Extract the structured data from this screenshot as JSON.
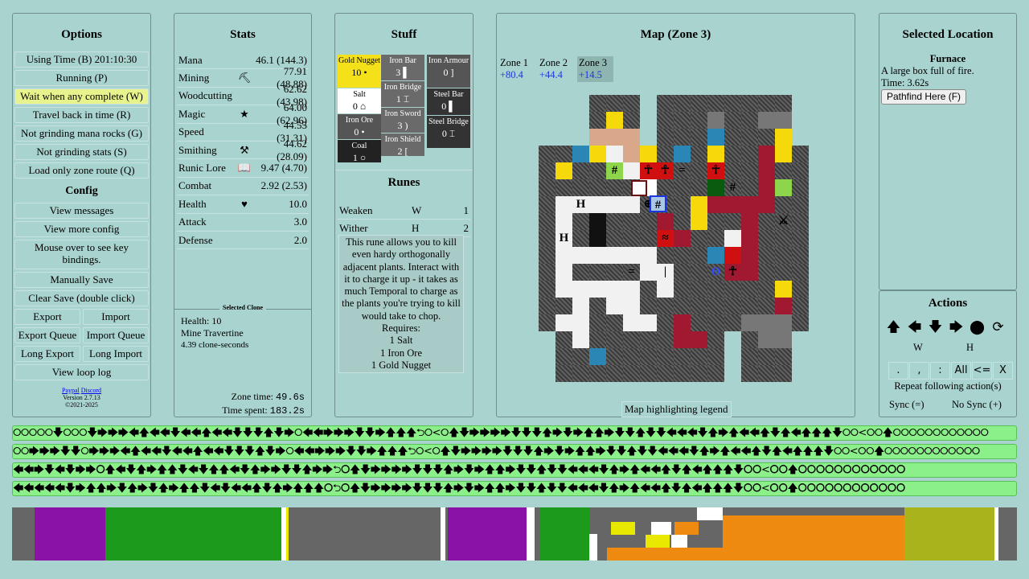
{
  "options": {
    "title": "Options",
    "items": [
      "Using Time (B) 201:10:30",
      "Running (P)",
      "Wait when any complete (W)",
      "Travel back in time (R)",
      "Not grinding mana rocks (G)",
      "Not grinding stats (S)",
      "Load only zone route (Q)"
    ],
    "config_title": "Config",
    "config_items": [
      "View messages",
      "View more config",
      "Mouse over to see key bindings.",
      "Manually Save",
      "Clear Save (double click)"
    ],
    "export": "Export",
    "import": "Import",
    "export_queue": "Export Queue",
    "import_queue": "Import Queue",
    "long_export": "Long Export",
    "long_import": "Long Import",
    "view_loop_log": "View loop log",
    "paypal": "Paypal",
    "discord": "Discord",
    "version": "Version 2.7.13",
    "copyright": "©2021-2025"
  },
  "stats": {
    "title": "Stats",
    "rows": [
      {
        "name": "Mana",
        "icon": "",
        "value": "46.1 (144.3)"
      },
      {
        "name": "Mining",
        "icon": "⛏",
        "value": "77.91 (48.88)"
      },
      {
        "name": "Woodcutting",
        "icon": "",
        "value": "62.62 (43.98)"
      },
      {
        "name": "Magic",
        "icon": "★",
        "value": "64.00 (62.96)"
      },
      {
        "name": "Speed",
        "icon": "",
        "value": "44.55 (31.31)"
      },
      {
        "name": "Smithing",
        "icon": "⚒",
        "value": "44.62 (28.09)"
      },
      {
        "name": "Runic Lore",
        "icon": "📖",
        "value": "9.47 (4.70)"
      },
      {
        "name": "Combat",
        "icon": "",
        "value": "2.92 (2.53)"
      },
      {
        "name": "Health",
        "icon": "♥",
        "value": "10.0"
      },
      {
        "name": "Attack",
        "icon": "",
        "value": "3.0"
      },
      {
        "name": "Defense",
        "icon": "",
        "value": "2.0"
      }
    ],
    "selected_clone_title": "Selected Clone",
    "clone_health": "Health: 10",
    "clone_action": "Mine Travertine",
    "clone_seconds": "4.39 clone-seconds",
    "zone_time_label": "Zone time:",
    "zone_time": "49.6s",
    "time_spent_label": "Time spent:",
    "time_spent": "183.2s"
  },
  "stuff": {
    "title": "Stuff",
    "items": [
      {
        "name": "Gold Nugget",
        "count": "10 •",
        "bg": "#f5e11a",
        "fg": "#000"
      },
      {
        "name": "Salt",
        "count": "0 ⌂",
        "bg": "#ffffff",
        "fg": "#000"
      },
      {
        "name": "Iron Ore",
        "count": "0 •",
        "bg": "#555555",
        "fg": "#fff"
      },
      {
        "name": "Coal",
        "count": "1 ○",
        "bg": "#222222",
        "fg": "#fff"
      },
      {
        "name": "Iron Bar",
        "count": "3 ▌",
        "bg": "#6a6a6a",
        "fg": "#fff"
      },
      {
        "name": "Iron Bridge",
        "count": "1 ⌶",
        "bg": "#6a6a6a",
        "fg": "#fff"
      },
      {
        "name": "Iron Sword",
        "count": "3 )",
        "bg": "#6a6a6a",
        "fg": "#fff"
      },
      {
        "name": "Iron Shield",
        "count": "2 [",
        "bg": "#6a6a6a",
        "fg": "#fff"
      },
      {
        "name": "Iron Armour",
        "count": "0 ]",
        "bg": "#555555",
        "fg": "#fff"
      },
      {
        "name": "Steel Bar",
        "count": "0 ▌",
        "bg": "#333333",
        "fg": "#fff"
      },
      {
        "name": "Steel Bridge",
        "count": "0 ⌶",
        "bg": "#333333",
        "fg": "#fff"
      }
    ],
    "runes_title": "Runes",
    "runes": [
      {
        "name": "Weaken",
        "key": "W",
        "count": "1"
      },
      {
        "name": "Wither",
        "key": "H",
        "count": "2"
      }
    ],
    "tooltip": [
      "This rune allows you to kill even hardy orthogonally adjacent plants. Interact with it to charge it up - it takes as much Temporal to charge as the plants you're trying to kill would take to chop.",
      "Requires:",
      "1 Salt",
      "1 Iron Ore",
      "1 Gold Nugget"
    ]
  },
  "map": {
    "title": "Map (Zone 3)",
    "zones": [
      {
        "name": "Zone 1",
        "value": "+80.4"
      },
      {
        "name": "Zone 2",
        "value": "+44.4"
      },
      {
        "name": "Zone 3",
        "value": "+14.5"
      }
    ],
    "legend_button": "Map highlighting legend"
  },
  "location": {
    "title": "Selected Location",
    "name": "Furnace",
    "description": "A large box full of fire.",
    "time": "Time: 3.62s",
    "pathfind": "Pathfind Here (F)"
  },
  "actions": {
    "title": "Actions",
    "arrows": [
      "🡅",
      "🡄",
      "🡇",
      "🡆",
      "⬤",
      "⟳"
    ],
    "rune_w": "W",
    "rune_h": "H",
    "row": [
      ".",
      ",",
      ":",
      "All",
      "<=",
      "X"
    ],
    "repeat": "Repeat following action(s)",
    "sync": "Sync (=)",
    "nosync": "No Sync (+)"
  },
  "queues": [
    "⭘⭘⭘⭘⭘🡇⭘⭘⭘🡇🡆🡆🡆🡄🡅🡄🡄🡇🡄🡄🡅🡄🡄🡇🡇🡇🡅🡇🡆⭘🡄🡄🡆🡆🡆🡇🡇🡆🡅🡅🡅⮌⭘<⭘🡅🡇🡆🡆🡆🡆🡇🡇🡇🡅🡆🡇🡆🡅🡅🡆🡇🡇🡅🡇🡇🡄🡄🡄🡇🡅🡆🡅🡄🡄🡅🡇🡅🡄🡅🡅🡅🡇⭘⭘<⭘⭘🡅⭘⭘⭘⭘⭘⭘⭘⭘⭘⭘⭘⭘",
    "⭘⭘🡆🡆🡆🡇🡇⭘🡆🡆🡆🡄🡅🡄🡄🡇🡄🡄🡅🡄🡄🡇🡇🡇🡅🡇🡆⭘🡄🡄🡆🡆🡆🡇🡇🡆🡅🡅🡅⮌⭘<⭘🡅🡇🡆🡆🡆🡆🡇🡇🡇🡅🡆🡇🡆🡅🡅🡆🡇🡇🡅🡇🡇🡄🡄🡄🡇🡅🡆🡅🡄🡄🡅🡇🡅🡄🡅🡅🡅🡇⭘⭘<⭘⭘🡅⭘⭘⭘⭘⭘⭘⭘⭘⭘⭘⭘⭘",
    "🡄🡄🡆🡇🡄🡇🡆🡆⭘🡅🡄🡇🡅🡆🡅🡅🡇🡄🡇🡅🡅🡄🡇🡅🡆🡆🡇🡇🡅🡆🡆⮌⭘🡅🡇🡆🡆🡆🡆🡇🡇🡇🡅🡆🡇🡆🡅🡅🡆🡇🡇🡅🡇🡇🡄🡄🡄🡇🡅🡆🡅🡄🡄🡅🡇🡅🡄🡅🡅🡅🡇⭘⭘<⭘⭘🡅⭘⭘⭘⭘⭘⭘⭘⭘⭘⭘⭘⭘",
    "🡄🡄🡄🡄🡄🡇🡆🡅🡅🡆🡇🡅🡆🡇🡅🡆🡅🡅🡇🡄🡇🡄🡄🡅🡇🡅🡆🡅🡅🡅⭘⮌⭘🡅🡇🡆🡆🡆🡆🡇🡇🡇🡅🡆🡇🡆🡅🡅🡆🡇🡇🡅🡇🡇🡄🡄🡄🡇🡅🡆🡅🡄🡄🡅🡇🡅🡄🡅🡅🡅🡇⭘⭘<⭘⭘🡅⭘⭘⭘⭘⭘⭘⭘⭘⭘⭘⭘⭘"
  ],
  "colors": {
    "bg": "#a9d3cf",
    "queue": "#8cf08a",
    "purple": "#8b12a6",
    "green": "#1b9a1b",
    "orange": "#ef8a10",
    "olive": "#a9b31c"
  }
}
